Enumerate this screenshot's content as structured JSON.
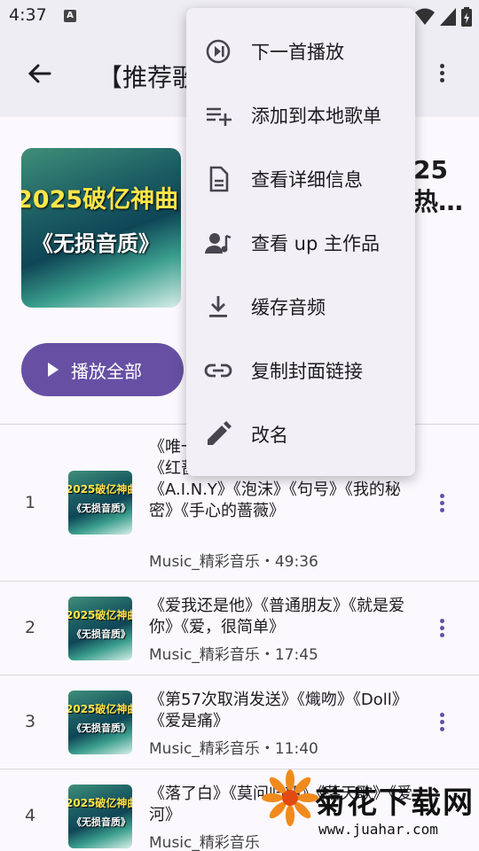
{
  "status": {
    "time": "4:37",
    "badge": "A"
  },
  "app_bar": {
    "title": "【推荐歌"
  },
  "header": {
    "title_peek_1": "25",
    "title_peek_2": "热…",
    "cover_line1": "2025破亿神曲",
    "cover_line2": "《无损音质》",
    "play_all_label": "播放全部"
  },
  "songs": [
    {
      "index": "1",
      "title": "《唯一…》《光年之外》《普通朋友》《红蔷薇白玫瑰》《来自天堂的魔鬼《A.I.N.Y》《泡沫》《句号》《我的秘密》《手心的蔷薇》",
      "sub": "Music_精彩音乐・49:36"
    },
    {
      "index": "2",
      "title": "《爱我还是他》《普通朋友》《就是爱你》《爱，很简单》",
      "sub": "Music_精彩音乐・17:45"
    },
    {
      "index": "3",
      "title": "《第57次取消发送》《熾吻》《Doll》《爱是痛》",
      "sub": "Music_精彩音乐・11:40"
    },
    {
      "index": "4",
      "title": "《落了白》《莫问归期》《落天歌》《爱河》",
      "sub": "Music_精彩音乐"
    }
  ],
  "song_cover": {
    "line1": "2025破亿神曲",
    "line2": "《无损音质》"
  },
  "menu": [
    {
      "label": "下一首播放",
      "icon": "play-next-icon"
    },
    {
      "label": "添加到本地歌单",
      "icon": "playlist-add-icon"
    },
    {
      "label": "查看详细信息",
      "icon": "document-icon"
    },
    {
      "label": "查看 up 主作品",
      "icon": "artist-icon"
    },
    {
      "label": "缓存音频",
      "icon": "download-icon"
    },
    {
      "label": "复制封面链接",
      "icon": "link-icon"
    },
    {
      "label": "改名",
      "icon": "edit-icon"
    }
  ],
  "watermark": {
    "name": "菊花下载网",
    "url": "www.juahar.com"
  },
  "colors": {
    "accent": "#6750a4",
    "surface": "#efedf4",
    "background": "#fbf9fd",
    "menu": "#f2eff7"
  }
}
